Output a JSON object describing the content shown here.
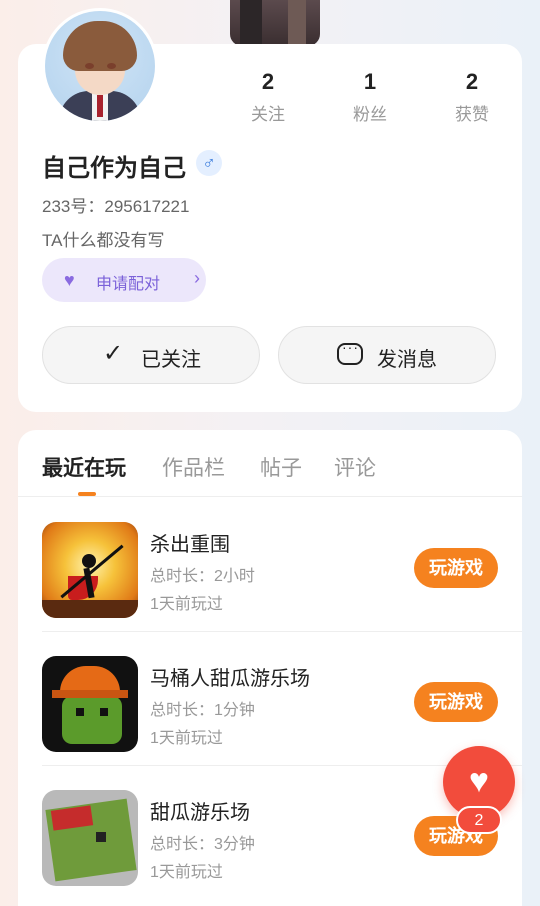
{
  "profile": {
    "username": "自己作为自己",
    "gender_icon": "male-icon",
    "gender_symbol": "♂",
    "uid": "233号：295617221",
    "bio": "TA什么都没有写",
    "pair_label": "申请配对",
    "stats": [
      {
        "num": "2",
        "label": "关注"
      },
      {
        "num": "1",
        "label": "粉丝"
      },
      {
        "num": "2",
        "label": "获赞"
      }
    ],
    "follow_label": "已关注",
    "message_label": "发消息"
  },
  "tabs": [
    "最近在玩",
    "作品栏",
    "帖子",
    "评论"
  ],
  "games": [
    {
      "title": "杀出重围",
      "duration": "总时长：2小时",
      "last": "1天前玩过",
      "play": "玩游戏"
    },
    {
      "title": "马桶人甜瓜游乐场",
      "duration": "总时长：1分钟",
      "last": "1天前玩过",
      "play": "玩游戏"
    },
    {
      "title": "甜瓜游乐场",
      "duration": "总时长：3分钟",
      "last": "1天前玩过",
      "play": "玩游戏"
    }
  ],
  "fab": {
    "symbol": "♥",
    "count": "2"
  },
  "colors": {
    "accent": "#f5821f",
    "fab": "#f24c3c",
    "pair_bg": "#ece7fb",
    "pair_text": "#7b62d9"
  }
}
